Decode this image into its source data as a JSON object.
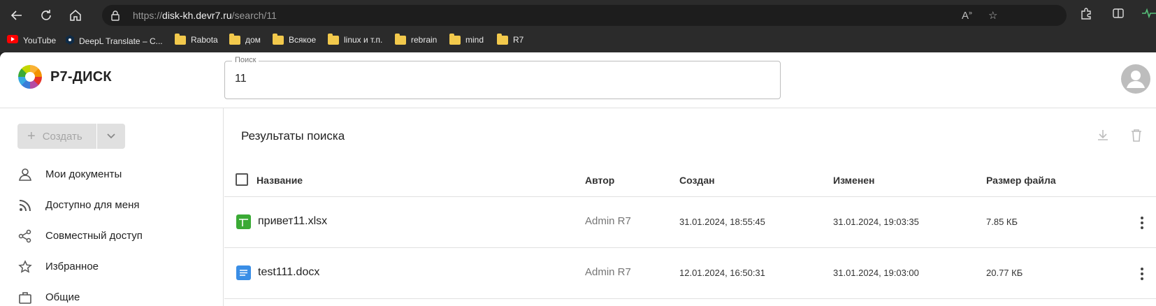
{
  "browser": {
    "url_prefix": "https://",
    "url_host": "disk-kh.devr7.ru",
    "url_path": "/search/11",
    "bookmarks": [
      {
        "label": "YouTube",
        "icon": "youtube-icon"
      },
      {
        "label": "DeepL Translate – C...",
        "icon": "deepl-icon"
      },
      {
        "label": "Rabota",
        "icon": "folder-icon"
      },
      {
        "label": "дом",
        "icon": "folder-icon"
      },
      {
        "label": "Всякое",
        "icon": "folder-icon"
      },
      {
        "label": "linux и т.п.",
        "icon": "folder-icon"
      },
      {
        "label": "rebrain",
        "icon": "folder-icon"
      },
      {
        "label": "mind",
        "icon": "folder-icon"
      },
      {
        "label": "R7",
        "icon": "folder-icon"
      }
    ]
  },
  "app": {
    "brand": "Р7-ДИСК",
    "search": {
      "label": "Поиск",
      "value": "11"
    }
  },
  "sidebar": {
    "create_label": "Создать",
    "items": [
      {
        "label": "Мои документы",
        "icon": "person-icon"
      },
      {
        "label": "Доступно для меня",
        "icon": "rss-icon"
      },
      {
        "label": "Совместный доступ",
        "icon": "share-icon"
      },
      {
        "label": "Избранное",
        "icon": "star-icon"
      },
      {
        "label": "Общие",
        "icon": "briefcase-icon"
      }
    ]
  },
  "main": {
    "title": "Результаты поиска",
    "columns": {
      "name": "Название",
      "author": "Автор",
      "created": "Создан",
      "modified": "Изменен",
      "size": "Размер файла"
    },
    "rows": [
      {
        "name": "привет11.xlsx",
        "type": "spreadsheet",
        "author": "Admin R7",
        "created": "31.01.2024, 18:55:45",
        "modified": "31.01.2024, 19:03:35",
        "size": "7.85 КБ"
      },
      {
        "name": "test111.docx",
        "type": "document",
        "author": "Admin R7",
        "created": "12.01.2024, 16:50:31",
        "modified": "31.01.2024, 19:03:00",
        "size": "20.77 КБ"
      }
    ]
  },
  "colors": {
    "spreadsheet": "#3aaa35",
    "document": "#3a8ee6",
    "accent": "#f39200"
  }
}
